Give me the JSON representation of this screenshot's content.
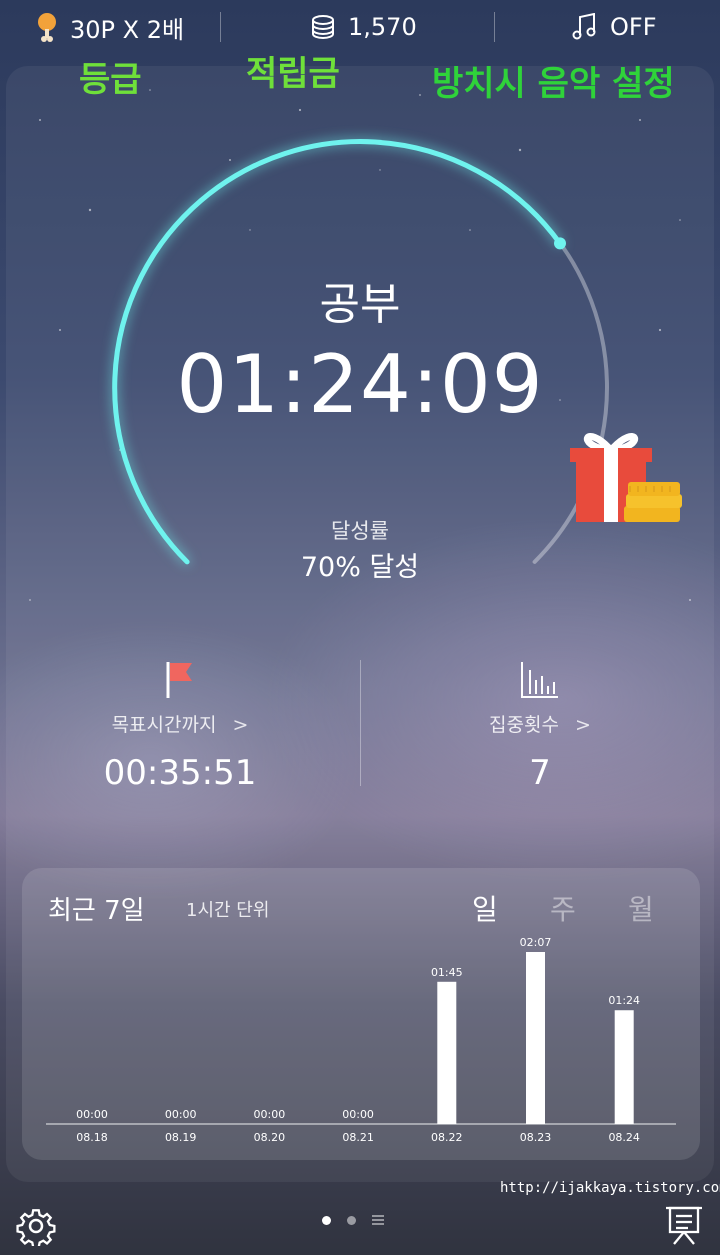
{
  "status": {
    "grade": "30P X 2배",
    "coins": "1,570",
    "music": "OFF"
  },
  "annotations": {
    "grade": "등급",
    "coins": "적립금",
    "music": "방치시 음악 설정"
  },
  "timer": {
    "mode": "공부",
    "elapsed": "01:24:09",
    "rate_label": "달성률",
    "rate_value": "70% 달성",
    "progress": 0.7
  },
  "stats": {
    "goal_label": "목표시간까지",
    "goal_value": "00:35:51",
    "focus_label": "집중횟수",
    "focus_value": "7"
  },
  "chart": {
    "title": "최근 7일",
    "unit": "1시간 단위",
    "periods": [
      "일",
      "주",
      "월"
    ],
    "selected_period": "일"
  },
  "chart_data": {
    "type": "bar",
    "categories": [
      "08.18",
      "08.19",
      "08.20",
      "08.21",
      "08.22",
      "08.23",
      "08.24"
    ],
    "values": [
      0,
      0,
      0,
      0,
      105,
      127,
      84
    ],
    "value_labels": [
      "00:00",
      "00:00",
      "00:00",
      "00:00",
      "01:45",
      "02:07",
      "01:24"
    ],
    "ylim": [
      0,
      127
    ]
  },
  "footer": {
    "watermark": "http://ijakkaya.tistory.com"
  },
  "colors": {
    "accent": "#6ff3ee",
    "annotation_green": "#6fe03a",
    "flag": "#f0665f",
    "gift": "#e84b3c"
  },
  "icons": {
    "grade": "drumstick-icon",
    "coins": "coin-stack-icon",
    "music": "music-note-icon",
    "gift": "gift-icon",
    "goal": "flag-icon",
    "focus": "bar-chart-icon",
    "settings": "gear-icon",
    "menu": "list-icon",
    "presentation": "presentation-icon"
  }
}
